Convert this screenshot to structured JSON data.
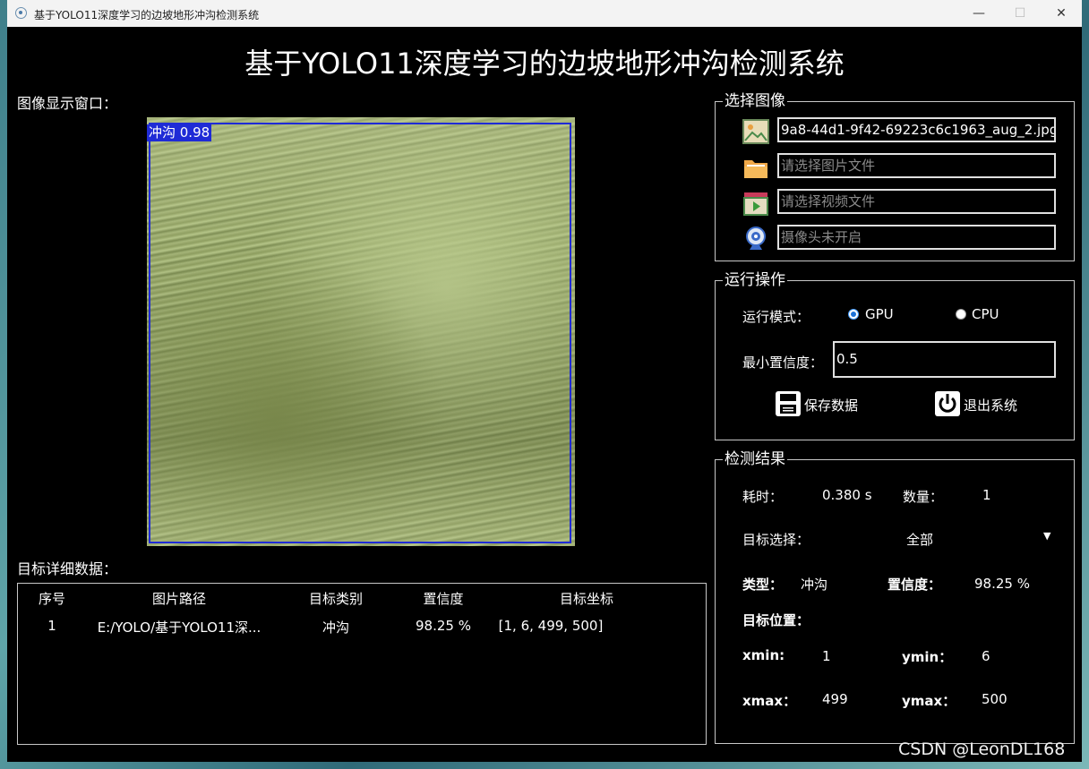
{
  "window": {
    "title": "基于YOLO11深度学习的边坡地形冲沟检测系统",
    "min_glyph": "—",
    "max_glyph": "☐",
    "close_glyph": "✕"
  },
  "header": {
    "title": "基于YOLO11深度学习的边坡地形冲沟检测系统"
  },
  "image_panel": {
    "label": "图像显示窗口：",
    "detection_label": "冲沟 0.98",
    "box_color": "#1f2bd6"
  },
  "select_image": {
    "title": "选择图像",
    "image_path": "9a8-44d1-9f42-69223c6c1963_aug_2.jpg",
    "image_placeholder": "请选择图片文件",
    "video_placeholder": "请选择视频文件",
    "camera_placeholder": "摄像头未开启"
  },
  "run_ops": {
    "title": "运行操作",
    "mode_label": "运行模式：",
    "gpu_label": "GPU",
    "cpu_label": "CPU",
    "selected_mode": "GPU",
    "conf_label": "最小置信度：",
    "conf_value": "0.5",
    "save_label": "保存数据",
    "exit_label": "退出系统"
  },
  "results": {
    "title": "检测结果",
    "time_label": "耗时：",
    "time_value": "0.380 s",
    "count_label": "数量：",
    "count_value": "1",
    "target_select_label": "目标选择：",
    "target_select_value": "全部",
    "type_label": "类型：",
    "type_value": "冲沟",
    "conf_label": "置信度：",
    "conf_value": "98.25 %",
    "position_label": "目标位置：",
    "xmin_label": "xmin:",
    "xmin_value": "1",
    "ymin_label": "ymin：",
    "ymin_value": "6",
    "xmax_label": "xmax：",
    "xmax_value": "499",
    "ymax_label": "ymax：",
    "ymax_value": "500"
  },
  "details": {
    "label": "目标详细数据：",
    "columns": [
      "序号",
      "图片路径",
      "目标类别",
      "置信度",
      "目标坐标"
    ],
    "rows": [
      [
        "1",
        "E:/YOLO/基于YOLO11深...",
        "冲沟",
        "98.25 %",
        "[1, 6, 499, 500]"
      ]
    ]
  },
  "watermark": "CSDN @LeonDL168"
}
